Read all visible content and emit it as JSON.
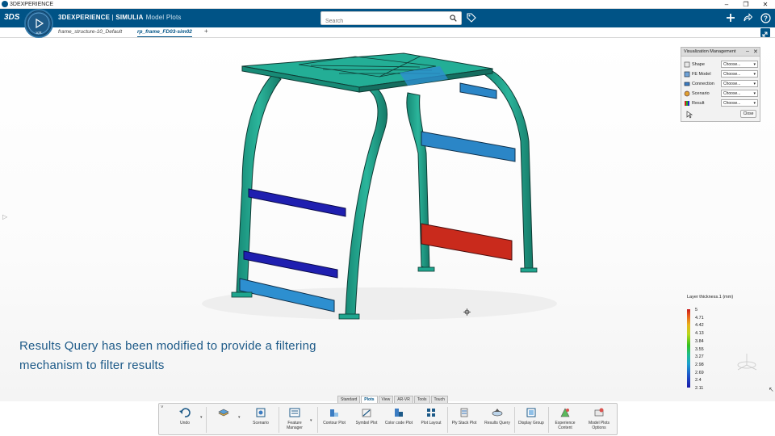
{
  "os": {
    "title": "3DEXPERIENCE",
    "controls": [
      "–",
      "❐",
      "✕"
    ]
  },
  "header": {
    "brand_bold": "3DEXPERIENCE",
    "brand_sep": " | ",
    "brand_app": "SIMULIA",
    "brand_module": "Model Plots",
    "compass_label": "V,R",
    "search": {
      "placeholder": "Search",
      "value": ""
    }
  },
  "tabs": [
    {
      "label": "frame_structure-10_Default",
      "active": false
    },
    {
      "label": "rp_frame_FD03-sim02",
      "active": true
    }
  ],
  "add_tab": "+",
  "viz_panel": {
    "title": "Visualization Management",
    "rows": [
      {
        "label": "Shape",
        "value": "Choose..."
      },
      {
        "label": "FE Model",
        "value": "Choose..."
      },
      {
        "label": "Connection",
        "value": "Choose..."
      },
      {
        "label": "Scenario",
        "value": "Choose..."
      },
      {
        "label": "Result",
        "value": "Choose..."
      }
    ],
    "close_label": "Close"
  },
  "caption": {
    "line1": "Results Query has been modified to provide a filtering",
    "line2": "mechanism to filter results"
  },
  "legend": {
    "title": "Layer thickness.1 (mm)",
    "ticks": [
      "5",
      "4.71",
      "4.42",
      "4.13",
      "3.84",
      "3.55",
      "3.27",
      "2.98",
      "2.69",
      "2.4",
      "2.11"
    ]
  },
  "ribbon_tabs": [
    {
      "label": "Standard",
      "active": false
    },
    {
      "label": "Plots",
      "active": true
    },
    {
      "label": "View",
      "active": false
    },
    {
      "label": "AR-VR",
      "active": false
    },
    {
      "label": "Tools",
      "active": false
    },
    {
      "label": "Touch",
      "active": false
    }
  ],
  "ribbon": [
    {
      "label": "Undo"
    },
    {
      "label": ""
    },
    {
      "label": "Scenario"
    },
    {
      "label": "Feature Manager"
    },
    {
      "label": "Contour Plot"
    },
    {
      "label": "Symbol Plot"
    },
    {
      "label": "Color code Plot"
    },
    {
      "label": "Plot Layout"
    },
    {
      "label": "Ply Stack Plot"
    },
    {
      "label": "Results Query"
    },
    {
      "label": "Display Group"
    },
    {
      "label": "Experience Content"
    },
    {
      "label": "Model Plots Options"
    }
  ],
  "colors": {
    "brand_blue": "#005386",
    "frame_teal": "#1fa58e",
    "bar_blue": "#1f1fb0",
    "bar_red": "#c8281a",
    "bar_lightblue": "#2d8fd0"
  }
}
